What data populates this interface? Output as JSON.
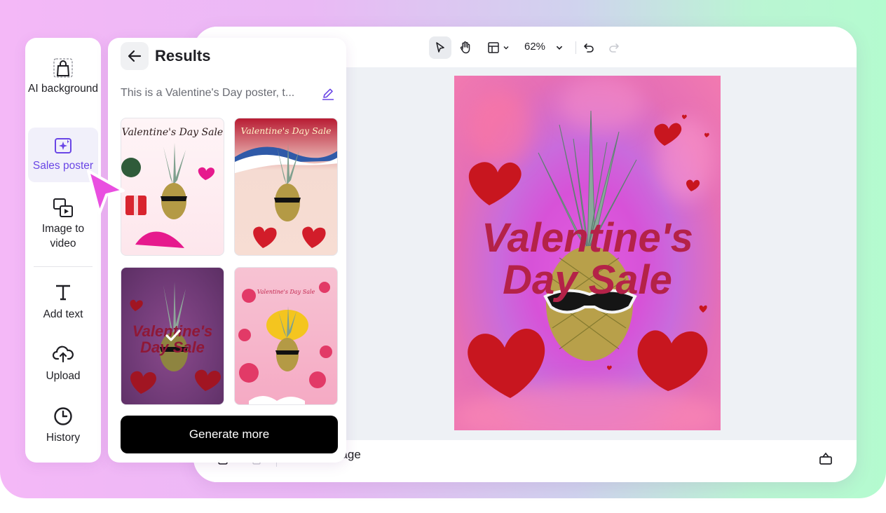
{
  "toolbar": {
    "zoom_level": "62%"
  },
  "poster": {
    "title_line1": "Valentine's",
    "title_line2": "Day Sale"
  },
  "bottom_bar": {
    "add_page_label": "Add page"
  },
  "nav": {
    "items": [
      {
        "label": "AI background",
        "icon": "shopping-bag-icon"
      },
      {
        "label": "Sales poster",
        "icon": "sparkle-image-icon",
        "active": true
      },
      {
        "label": "Image to video",
        "icon": "image-video-icon"
      },
      {
        "label": "Add text",
        "icon": "text-t-icon"
      },
      {
        "label": "Upload",
        "icon": "cloud-upload-icon"
      },
      {
        "label": "History",
        "icon": "clock-icon"
      }
    ]
  },
  "results": {
    "title": "Results",
    "prompt": "This is a Valentine's Day poster, t...",
    "thumbnails": [
      {
        "title": "Valentine's Day Sale"
      },
      {
        "title": "Valentine's Day Sale"
      },
      {
        "title_line1": "Valentine's",
        "title_line2": "Day Sale",
        "selected": true
      },
      {
        "title": "Valentine's Day Sale"
      }
    ],
    "generate_more_label": "Generate more"
  },
  "colors": {
    "accent": "#6a46e6",
    "cursor": "#e94fe0",
    "poster_text": "#b42248"
  }
}
